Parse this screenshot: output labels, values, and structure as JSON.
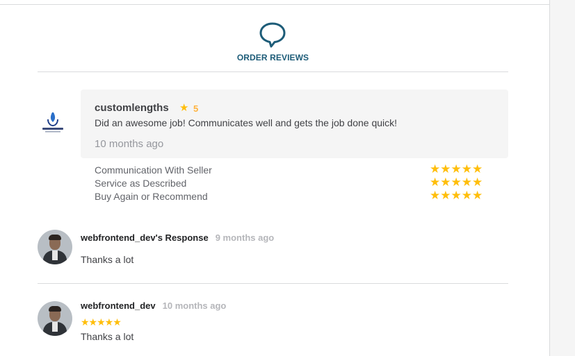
{
  "header": {
    "title": "ORDER REVIEWS",
    "icon": "chat-bubble-icon",
    "accent": "#1d5c78"
  },
  "review": {
    "logo": "company-logo",
    "reviewer": "customlengths",
    "rating": "5",
    "comment": "Did an awesome job! Communicates well and gets the job done quick!",
    "time": "10 months ago",
    "star_color": "#ffbe0b",
    "criteria": [
      {
        "label": "Communication With Seller",
        "stars": 5
      },
      {
        "label": "Service as Described",
        "stars": 5
      },
      {
        "label": "Buy Again or Recommend",
        "stars": 5
      }
    ]
  },
  "seller_response": {
    "name": "webfrontend_dev's Response",
    "time": "9 months ago",
    "message": "Thanks a lot"
  },
  "seller_review": {
    "name": "webfrontend_dev",
    "time": "10 months ago",
    "stars": 5,
    "message": "Thanks a lot"
  }
}
